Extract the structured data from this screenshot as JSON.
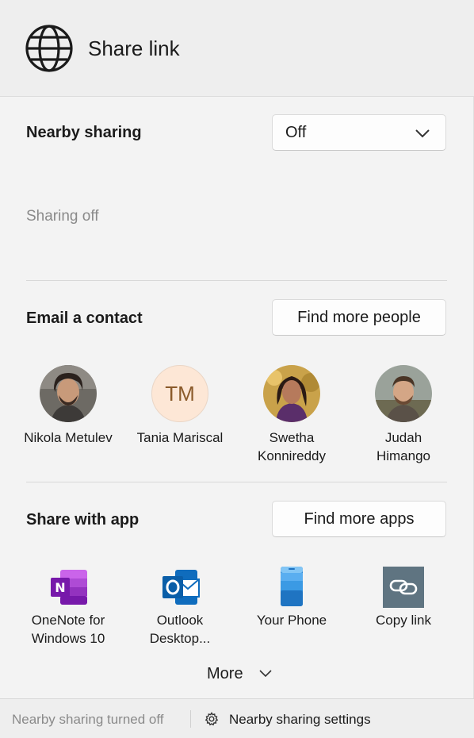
{
  "header": {
    "title": "Share link",
    "icon": "globe-icon"
  },
  "nearby": {
    "label": "Nearby sharing",
    "dropdown_value": "Off",
    "status": "Sharing off"
  },
  "email": {
    "label": "Email a contact",
    "find_button": "Find more people",
    "contacts": [
      {
        "name": "Nikola Metulev"
      },
      {
        "name": "Tania Mariscal",
        "initials": "TM"
      },
      {
        "name_line1": "Swetha",
        "name_line2": "Konnireddy"
      },
      {
        "name_line1": "Judah",
        "name_line2": "Himango"
      }
    ]
  },
  "apps": {
    "label": "Share with app",
    "find_button": "Find more apps",
    "items": [
      {
        "line1": "OneNote for",
        "line2": "Windows 10",
        "icon": "onenote-icon"
      },
      {
        "line1": "Outlook",
        "line2": "Desktop...",
        "icon": "outlook-icon"
      },
      {
        "line1": "Your Phone",
        "icon": "your-phone-icon"
      },
      {
        "line1": "Copy link",
        "icon": "link-icon"
      }
    ],
    "more_label": "More"
  },
  "footer": {
    "status": "Nearby sharing turned off",
    "settings_link": "Nearby sharing settings"
  },
  "colors": {
    "background": "#f3f3f3",
    "onenote": "#7719aa",
    "outlook": "#0f6cbd",
    "yourphone": "#2b88d8",
    "copylink": "#5f7481",
    "avatar_initials_bg": "#fde7d6"
  }
}
